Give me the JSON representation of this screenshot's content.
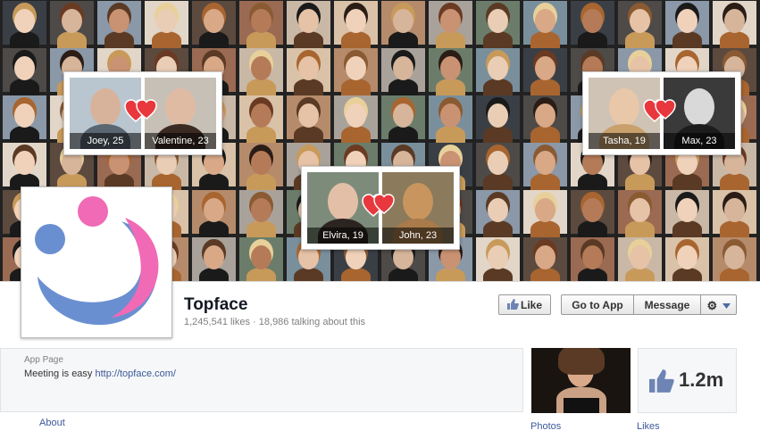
{
  "page": {
    "title": "Topface",
    "stats": "1,245,541 likes · 18,986 talking about this",
    "app_page_label": "App Page",
    "description_text": "Meeting is easy ",
    "description_link": "http://topface.com/"
  },
  "buttons": {
    "like": "Like",
    "go_to_app": "Go to App",
    "message": "Message"
  },
  "sections": {
    "about": "About",
    "photos": "Photos",
    "likes_label": "Likes",
    "likes_count": "1.2m"
  },
  "pairs": [
    {
      "left_name": "Joey, 25",
      "right_name": "Valentine, 23"
    },
    {
      "left_name": "Tasha, 19",
      "right_name": "Max, 23"
    },
    {
      "left_name": "Elvira, 19",
      "right_name": "John, 23"
    }
  ],
  "colors": {
    "link": "#3b5998",
    "logo_pink": "#f06ab5",
    "logo_blue": "#6a8fd1",
    "heart": "#e8373d"
  },
  "icons": {
    "like_button": "thumbs-up-icon",
    "gear_button": "gear-icon",
    "dropdown": "caret-down-icon",
    "likes_box": "thumbs-up-icon",
    "pair_match": "hearts-icon",
    "profile": "topface-logo"
  }
}
